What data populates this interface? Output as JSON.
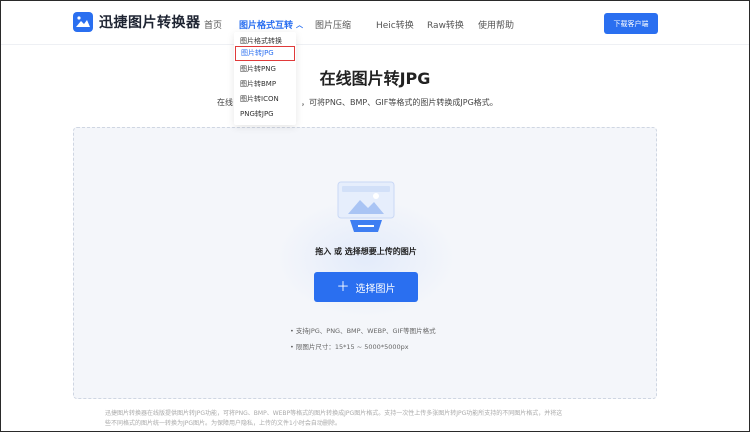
{
  "header": {
    "logo_text": "迅捷图片转换器",
    "nav": [
      {
        "label": "首页"
      },
      {
        "label": "图片格式互转"
      },
      {
        "label": "图片压缩"
      },
      {
        "label": "Heic转换"
      },
      {
        "label": "Raw转换"
      },
      {
        "label": "使用帮助"
      }
    ],
    "download_label": "下载客户端"
  },
  "dropdown": {
    "items": [
      "图片格式转换",
      "图片转JPG",
      "图片转PNG",
      "图片转BMP",
      "图片转ICON",
      "PNG转JPG"
    ],
    "selected_index": 1
  },
  "main": {
    "title": "在线图片转JPG",
    "subtitle_start": "在线",
    "subtitle_tail": "，可将PNG、BMP、GIF等格式的图片转换成JPG格式。"
  },
  "upload": {
    "hint": "拖入 或 选择想要上传的图片",
    "button_label": "选择图片",
    "notes": [
      "• 支持JPG、PNG、BMP、WEBP、GIF等图片格式",
      "• 限图片尺寸：15*15 ~ 5000*5000px"
    ]
  },
  "footer": {
    "lines": [
      "迅捷图片转换器在线版提供图片转JPG功能，可将PNG、BMP、WEBP等格式的图片转换成JPG图片格式。支持一次性上传多张图片转JPG功能所支持的不同图片格式，并将这",
      "些不同格式的图片统一转换为JPG图片。为保障用户隐私，上传的文件1小时会自动删除。"
    ]
  },
  "colors": {
    "accent": "#2a6ff0",
    "selected_border": "#e03a3a"
  }
}
